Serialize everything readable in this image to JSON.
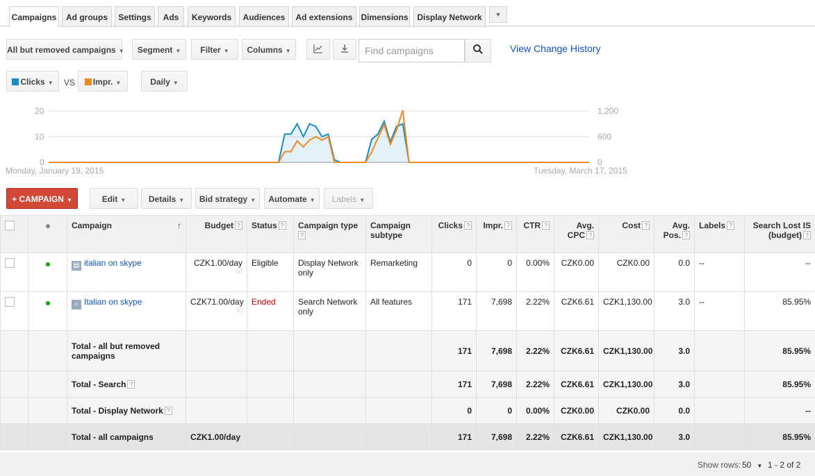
{
  "tabs": [
    "Campaigns",
    "Ad groups",
    "Settings",
    "Ads",
    "Keywords",
    "Audiences",
    "Ad extensions",
    "Dimensions",
    "Display Network"
  ],
  "toolbar": {
    "scope_label": "All but removed campaigns",
    "segment_label": "Segment",
    "filter_label": "Filter",
    "columns_label": "Columns",
    "search_placeholder": "Find campaigns",
    "history_link": "View Change History"
  },
  "chart_controls": {
    "metric1": "Clicks",
    "vs": "VS",
    "metric2": "Impr.",
    "period": "Daily",
    "metric1_color": "#1a8cc4",
    "metric2_color": "#f08a24"
  },
  "chart_data": {
    "type": "line",
    "x_start_label": "Monday, January 19, 2015",
    "x_end_label": "Tuesday, March 17, 2015",
    "y_left_ticks": [
      "20",
      "10",
      "0"
    ],
    "y_right_ticks": [
      "1,200",
      "600",
      "0"
    ],
    "ylim_left": [
      0,
      20
    ],
    "ylim_right": [
      0,
      1200
    ],
    "series": [
      {
        "name": "Clicks",
        "color": "#1a8cc4",
        "axis": "left",
        "values": [
          0,
          0,
          0,
          0,
          0,
          0,
          0,
          0,
          0,
          0,
          0,
          0,
          0,
          0,
          0,
          0,
          0,
          0,
          0,
          0,
          0,
          0,
          0,
          0,
          0,
          0,
          0,
          0,
          0,
          0,
          0,
          0,
          0,
          0,
          0,
          0,
          0,
          0,
          11,
          11,
          15,
          10,
          15,
          14,
          10,
          11,
          1,
          0,
          0,
          0,
          0,
          0,
          9,
          11,
          16,
          8,
          14,
          15,
          0,
          0,
          0,
          0,
          0,
          0,
          0,
          0,
          0,
          0,
          0,
          0,
          0,
          0,
          0,
          0,
          0,
          0,
          0,
          0,
          0,
          0,
          0,
          0,
          0,
          0,
          0,
          0,
          0,
          0
        ]
      },
      {
        "name": "Impr.",
        "color": "#f08a24",
        "axis": "right",
        "values": [
          0,
          0,
          0,
          0,
          0,
          0,
          0,
          0,
          0,
          0,
          0,
          0,
          0,
          0,
          0,
          0,
          0,
          0,
          0,
          0,
          0,
          0,
          0,
          0,
          0,
          0,
          0,
          0,
          0,
          0,
          0,
          0,
          0,
          0,
          0,
          0,
          0,
          0,
          250,
          250,
          500,
          360,
          520,
          600,
          520,
          600,
          0,
          0,
          0,
          0,
          0,
          0,
          240,
          570,
          880,
          420,
          760,
          1220,
          0,
          0,
          0,
          0,
          0,
          0,
          0,
          0,
          0,
          0,
          0,
          0,
          0,
          0,
          0,
          0,
          0,
          0,
          0,
          0,
          0,
          0,
          0,
          0,
          0,
          0,
          0,
          0,
          0,
          0
        ]
      }
    ]
  },
  "actions": {
    "new_campaign": "+ CAMPAIGN",
    "edit": "Edit",
    "details": "Details",
    "bid_strategy": "Bid strategy",
    "automate": "Automate",
    "labels": "Labels"
  },
  "table": {
    "headers": {
      "campaign": "Campaign",
      "budget": "Budget",
      "status": "Status",
      "campaign_type": "Campaign type",
      "campaign_subtype": "Campaign subtype",
      "clicks": "Clicks",
      "impr": "Impr.",
      "ctr": "CTR",
      "avg_cpc": "Avg. CPC",
      "cost": "Cost",
      "avg_pos": "Avg. Pos.",
      "labels": "Labels",
      "search_lost": "Search Lost IS (budget)"
    },
    "rows": [
      {
        "campaign": "italian on skype",
        "icon": "display-campaign-icon",
        "budget": "CZK1.00/day",
        "status": "Eligible",
        "type": "Display Network only",
        "subtype": "Remarketing",
        "clicks": "0",
        "impr": "0",
        "ctr": "0.00%",
        "cpc": "CZK0.00",
        "cost": "CZK0.00",
        "pos": "0.0",
        "labels": "--",
        "lost": "--"
      },
      {
        "campaign": "Italian on skype",
        "icon": "search-campaign-icon",
        "budget": "CZK71.00/day",
        "status": "Ended",
        "type": "Search Network only",
        "subtype": "All features",
        "clicks": "171",
        "impr": "7,698",
        "ctr": "2.22%",
        "cpc": "CZK6.61",
        "cost": "CZK1,130.00",
        "pos": "3.0",
        "labels": "--",
        "lost": "85.95%"
      }
    ],
    "totals": [
      {
        "label": "Total - all but removed campaigns",
        "budget": "",
        "clicks": "171",
        "impr": "7,698",
        "ctr": "2.22%",
        "cpc": "CZK6.61",
        "cost": "CZK1,130.00",
        "pos": "3.0",
        "lost": "85.95%"
      },
      {
        "label": "Total - Search",
        "budget": "",
        "clicks": "171",
        "impr": "7,698",
        "ctr": "2.22%",
        "cpc": "CZK6.61",
        "cost": "CZK1,130.00",
        "pos": "3.0",
        "lost": "85.95%"
      },
      {
        "label": "Total - Display Network",
        "budget": "",
        "clicks": "0",
        "impr": "0",
        "ctr": "0.00%",
        "cpc": "CZK0.00",
        "cost": "CZK0.00",
        "pos": "0.0",
        "lost": "--"
      },
      {
        "label": "Total - all campaigns",
        "budget": "CZK1.00/day",
        "clicks": "171",
        "impr": "7,698",
        "ctr": "2.22%",
        "cpc": "CZK6.61",
        "cost": "CZK1,130.00",
        "pos": "3.0",
        "lost": "85.95%"
      }
    ]
  },
  "footer": {
    "show_rows_label": "Show rows:",
    "rows_value": "50",
    "range": "1 - 2 of 2"
  }
}
